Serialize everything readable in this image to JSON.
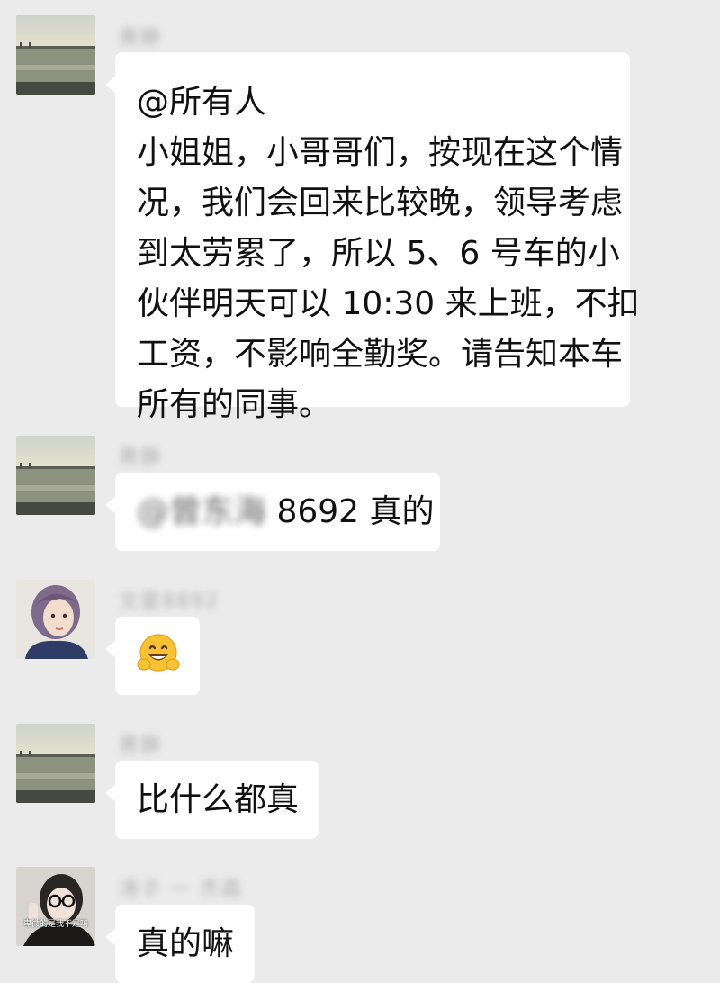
{
  "messages": [
    {
      "id": "m1",
      "avatar": "seaside-pier-avatar",
      "sender": "黄静",
      "lines": [
        "@所有人",
        "小姐姐，小哥哥们，按现在这个情",
        "况，我们会回来比较晚，领导考虑",
        "到太劳累了，所以 5、6 号车的小",
        "伙伴明天可以 10:30 来上班，不扣",
        "工资，不影响全勤奖。请告知本车",
        "所有的同事。"
      ]
    },
    {
      "id": "m2",
      "avatar": "seaside-pier-avatar",
      "sender": "黄静",
      "mention": "@曾东海",
      "text": "8692  真的"
    },
    {
      "id": "m3",
      "avatar": "girl-portrait-avatar",
      "sender": "文星8892",
      "emoji": "hugging-face-emoji"
    },
    {
      "id": "m4",
      "avatar": "seaside-pier-avatar",
      "sender": "黄静",
      "text": "比什么都真"
    },
    {
      "id": "m5",
      "avatar": "glasses-girl-avatar",
      "avatar_caption": "卑微的是我不是吗",
      "sender": "涛子 一 杰森",
      "text": "真的嘛"
    }
  ],
  "colors": {
    "background": "#ebebeb",
    "bubble": "#ffffff",
    "text": "#111111",
    "name": "#b0b0b0"
  }
}
